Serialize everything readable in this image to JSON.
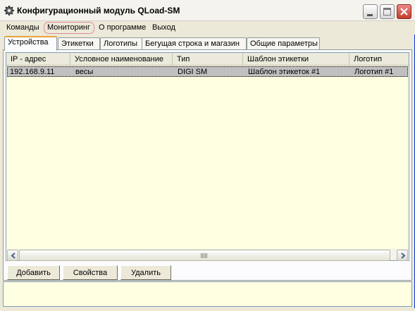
{
  "window": {
    "title": "Конфигурационный модуль QLoad-SM"
  },
  "menu": {
    "items": [
      {
        "label": "Команды"
      },
      {
        "label": "Мониторинг"
      },
      {
        "label": "О программе"
      },
      {
        "label": "Выход"
      }
    ]
  },
  "tabs": [
    {
      "label": "Устройства",
      "active": true
    },
    {
      "label": "Этикетки"
    },
    {
      "label": "Логотипы"
    },
    {
      "label": "Бегущая строка и магазин"
    },
    {
      "label": "Общие параметры"
    }
  ],
  "devices_table": {
    "columns": [
      "IP - адрес",
      "Условное наименование",
      "Тип",
      "Шаблон этикетки",
      "Логотип"
    ],
    "rows": [
      [
        "192.168.9.11",
        "весы",
        "DIGI SM",
        "Шаблон этикеток #1",
        "Логотип #1"
      ]
    ]
  },
  "buttons": {
    "add": "Добавить",
    "properties": "Свойства",
    "delete": "Удалить"
  },
  "colors": {
    "list_background": "#ffffe1",
    "selected_row": "#c0c0c0",
    "active_tab_accent": "#e8a33d",
    "menu_highlight_ring": "#e08a9a"
  },
  "icons": {
    "app": "gear-icon",
    "minimize": "minimize-icon",
    "maximize": "maximize-icon",
    "close": "close-icon",
    "scroll_left": "arrow-left-icon",
    "scroll_right": "arrow-right-icon"
  }
}
